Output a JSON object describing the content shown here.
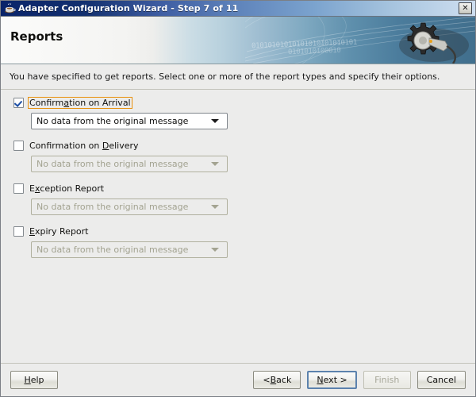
{
  "window": {
    "title": "Adapter Configuration Wizard - Step 7 of 11",
    "icon": "java-coffee-cup-icon",
    "close_label": "✕"
  },
  "banner": {
    "heading": "Reports",
    "art_icon": "gear-and-wrench-icon",
    "binary_line_1": "01010101010101010101010101",
    "binary_line_2": "0101010100010"
  },
  "instruction": "You have specified to get reports.  Select one or more of the report types and specify their options.",
  "options": [
    {
      "label_before": "Confirm",
      "mnemonic": "a",
      "label_after": "tion on Arrival",
      "checked": true,
      "focused": true,
      "combo_value": "No data from the original message",
      "combo_enabled": true
    },
    {
      "label_before": "Confirmation on ",
      "mnemonic": "D",
      "label_after": "elivery",
      "checked": false,
      "focused": false,
      "combo_value": "No data from the original message",
      "combo_enabled": false
    },
    {
      "label_before": "E",
      "mnemonic": "x",
      "label_after": "ception Report",
      "checked": false,
      "focused": false,
      "combo_value": "No data from the original message",
      "combo_enabled": false
    },
    {
      "label_before": "",
      "mnemonic": "E",
      "label_after": "xpiry Report",
      "checked": false,
      "focused": false,
      "combo_value": "No data from the original message",
      "combo_enabled": false
    }
  ],
  "buttons": {
    "help": {
      "before": "",
      "mnemonic": "H",
      "after": "elp"
    },
    "back": {
      "before": "< ",
      "mnemonic": "B",
      "after": "ack"
    },
    "next": {
      "before": "",
      "mnemonic": "N",
      "after": "ext >"
    },
    "finish": {
      "text": "Finish",
      "enabled": false
    },
    "cancel": {
      "text": "Cancel",
      "enabled": true
    }
  },
  "colors": {
    "titlebar_dark": "#0a246a",
    "titlebar_light": "#cfdff0",
    "focus_ring": "#e8900c",
    "check_blue": "#1d4fa6",
    "default_button_border": "#5c82ad",
    "face": "#ececeb"
  }
}
